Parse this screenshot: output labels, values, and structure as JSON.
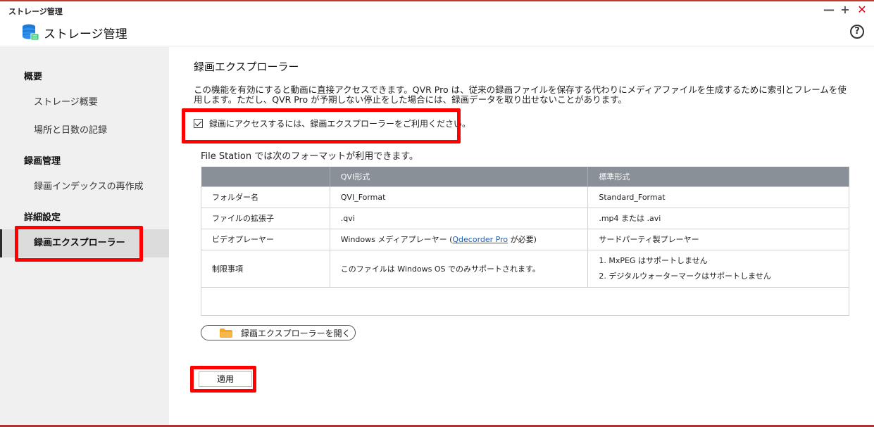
{
  "window": {
    "title": "ストレージ管理",
    "controls": {
      "minimize": "—",
      "maximize": "+",
      "close": "✕"
    }
  },
  "header": {
    "app_title": "ストレージ管理",
    "help": "?"
  },
  "sidebar": {
    "sections": [
      {
        "label": "概要",
        "items": [
          "ストレージ概要",
          "場所と日数の記録"
        ]
      },
      {
        "label": "録画管理",
        "items": [
          "録画インデックスの再作成"
        ]
      },
      {
        "label": "詳細設定",
        "items": [
          "録画エクスプローラー"
        ]
      }
    ],
    "active_item": "録画エクスプローラー"
  },
  "main": {
    "heading": "録画エクスプローラー",
    "description": "この機能を有効にすると動画に直接アクセスできます。QVR Pro は、従来の録画ファイルを保存する代わりにメディアファイルを生成するために索引とフレームを使用します。ただし、QVR Pro が予期しない停止をした場合には、録画データを取り出せないことがあります。",
    "checkbox_label": "録画にアクセスするには、録画エクスプローラーをご利用ください。",
    "checkbox_checked": true,
    "fs_note": "File Station では次のフォーマットが利用できます。",
    "table": {
      "headers": [
        "",
        "QVI形式",
        "標準形式"
      ],
      "rows": [
        {
          "label": "フォルダー名",
          "qvi": "QVI_Format",
          "std": "Standard_Format"
        },
        {
          "label": "ファイルの拡張子",
          "qvi": ".qvi",
          "std": ".mp4 または .avi"
        },
        {
          "label": "ビデオプレーヤー",
          "qvi_prefix": "Windows メディアプレーヤー (",
          "qvi_link": "Qdecorder Pro",
          "qvi_suffix": " が必要)",
          "std": "サードパーティ製プレーヤー"
        },
        {
          "label": "制限事項",
          "qvi": "このファイルは Windows OS でのみサポートされます。",
          "std_1": "1. MxPEG はサポートしません",
          "std_2": "2. デジタルウォーターマークはサポートしません"
        }
      ]
    },
    "open_button": "録画エクスプローラーを開く",
    "apply_button": "適用"
  },
  "colors": {
    "highlight": "#ff0000",
    "table_header": "#8a9098",
    "sidebar_bg": "#f0f0f0",
    "folder_icon": "#f5a623",
    "link": "#1a5fb4"
  }
}
